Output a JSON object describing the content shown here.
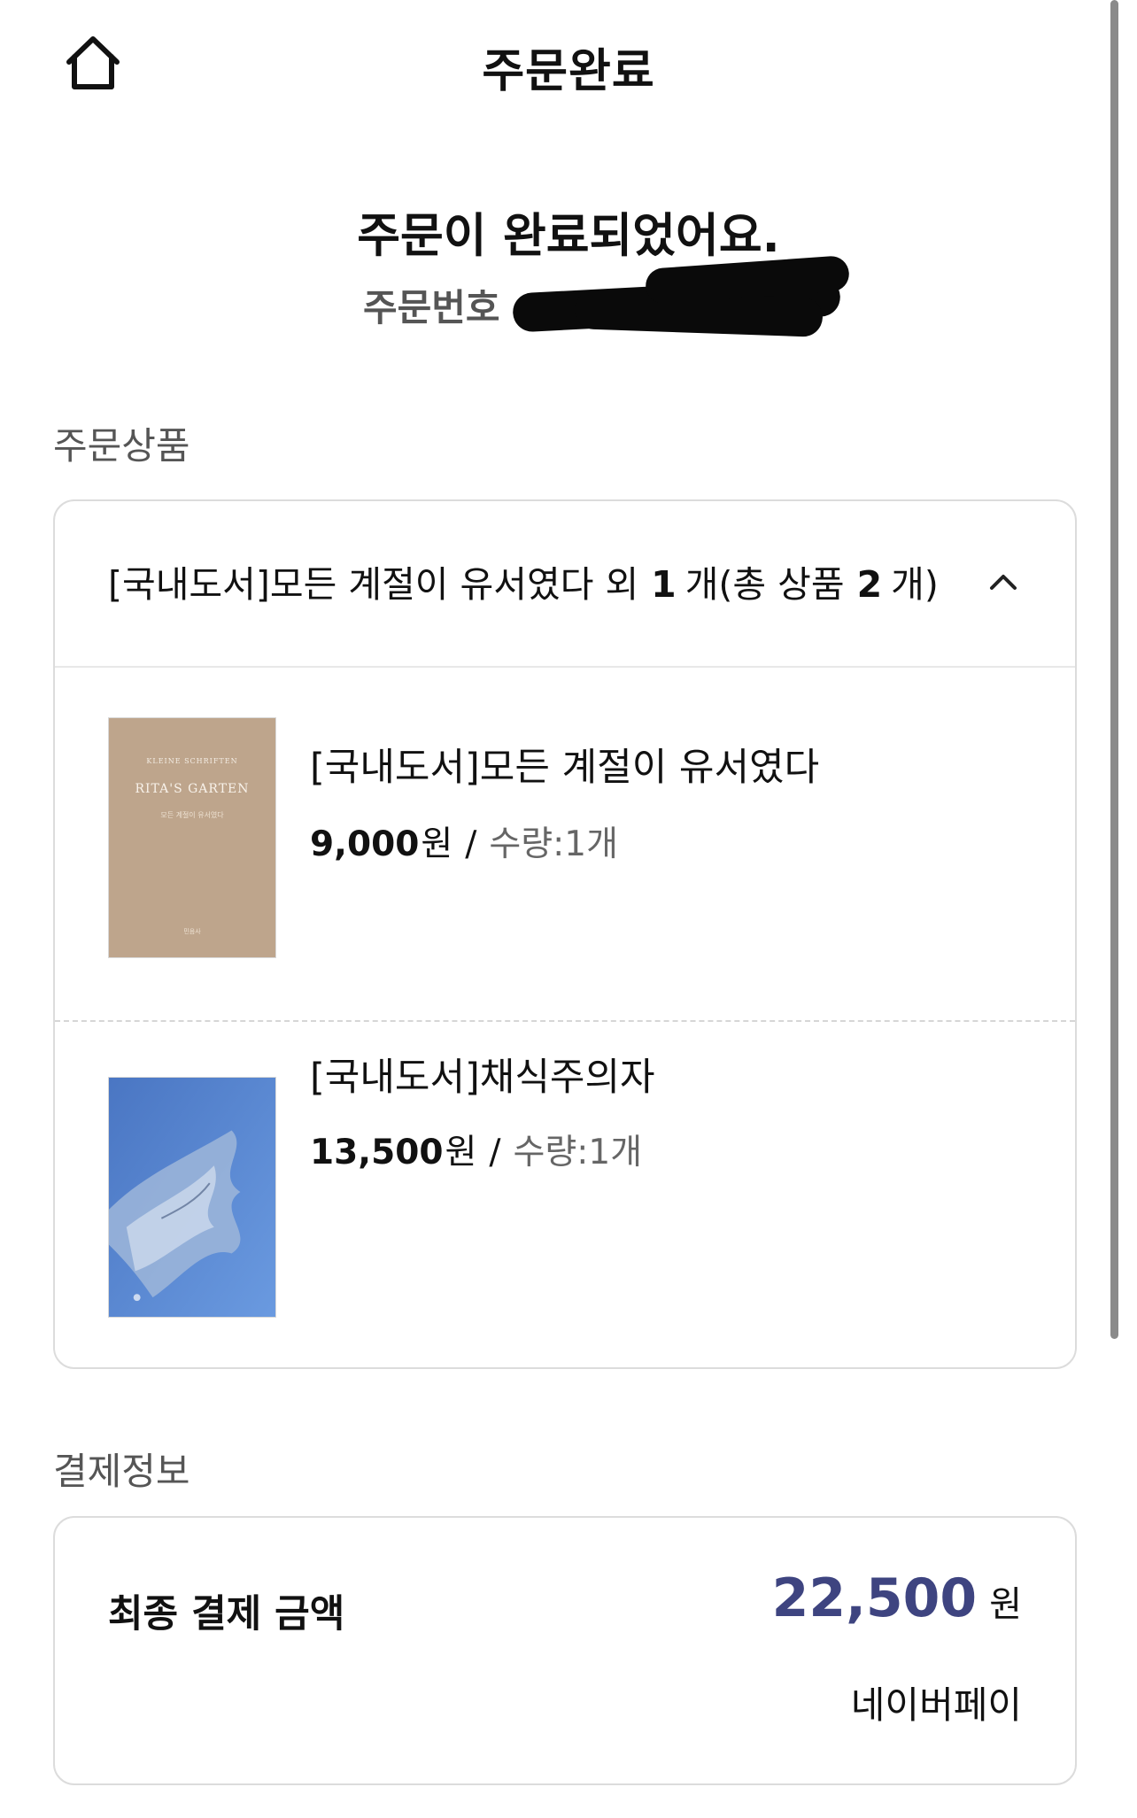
{
  "header": {
    "title": "주문완료",
    "home_icon": "home-icon"
  },
  "confirmation": {
    "message": "주문이 완료되었어요.",
    "order_number_label": "주문번호"
  },
  "order_products": {
    "section_label": "주문상품",
    "summary": {
      "prefix": "[국내도서]모든 계절이 유서였다 외",
      "extra_count": "1",
      "mid": "개(총 상품",
      "total_count": "2",
      "suffix": "개)"
    },
    "items": [
      {
        "name": "[국내도서]모든 계절이 유서였다",
        "price": "9,000",
        "currency": "원",
        "separator": "/",
        "quantity": "수량:1개",
        "cover_texts": [
          "KLEINE SCHRIFTEN",
          "RITA'S GARTEN",
          "모든 계절이 유서였다",
          "민음사"
        ],
        "cover_color": "#bea58c"
      },
      {
        "name": "[국내도서]채식주의자",
        "price": "13,500",
        "currency": "원",
        "separator": "/",
        "quantity": "수량:1개",
        "cover_color": "#5b87cf"
      }
    ]
  },
  "payment": {
    "section_label": "결제정보",
    "final_label": "최종 결제 금액",
    "amount": "22,500",
    "unit": "원",
    "method": "네이버페이",
    "amount_color": "#3e4480"
  }
}
